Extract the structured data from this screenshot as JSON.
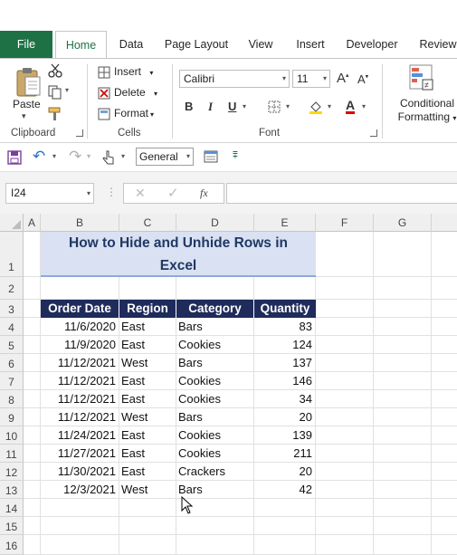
{
  "ribbon_tabs": [
    "File",
    "Home",
    "Data",
    "Page Layout",
    "View",
    "Insert",
    "Developer",
    "Review"
  ],
  "clipboard": {
    "paste_label": "Paste",
    "group_label": "Clipboard"
  },
  "cells": {
    "insert_label": "Insert",
    "delete_label": "Delete",
    "format_label": "Format",
    "group_label": "Cells"
  },
  "font": {
    "name": "Calibri",
    "size": "11",
    "group_label": "Font",
    "bold": "B",
    "italic": "I",
    "underline": "U"
  },
  "styles": {
    "conditional_label": "Conditional",
    "formatting_label": "Formatting"
  },
  "quick_access": {
    "number_format": "General"
  },
  "formula_bar": {
    "name_box": "I24",
    "fx": "fx",
    "value": ""
  },
  "columns": [
    "A",
    "B",
    "C",
    "D",
    "E",
    "F",
    "G"
  ],
  "rows": [
    "1",
    "2",
    "3",
    "4",
    "5",
    "6",
    "7",
    "8",
    "9",
    "10",
    "11",
    "12",
    "13",
    "14",
    "15",
    "16"
  ],
  "sheet": {
    "title_line1": "How to Hide and Unhide Rows in",
    "title_line2": "Excel",
    "headers": [
      "Order Date",
      "Region",
      "Category",
      "Quantity"
    ],
    "records": [
      [
        "11/6/2020",
        "East",
        "Bars",
        "83"
      ],
      [
        "11/9/2020",
        "East",
        "Cookies",
        "124"
      ],
      [
        "11/12/2021",
        "West",
        "Bars",
        "137"
      ],
      [
        "11/12/2021",
        "East",
        "Cookies",
        "146"
      ],
      [
        "11/12/2021",
        "East",
        "Cookies",
        "34"
      ],
      [
        "11/12/2021",
        "West",
        "Bars",
        "20"
      ],
      [
        "11/24/2021",
        "East",
        "Cookies",
        "139"
      ],
      [
        "11/27/2021",
        "East",
        "Cookies",
        "211"
      ],
      [
        "11/30/2021",
        "East",
        "Crackers",
        "20"
      ],
      [
        "12/3/2021",
        "West",
        "Bars",
        "42"
      ]
    ]
  },
  "colors": {
    "excel_green": "#1e7145",
    "header_navy": "#1f2b5b",
    "title_fill": "#d9e1f2",
    "title_text": "#203864"
  }
}
